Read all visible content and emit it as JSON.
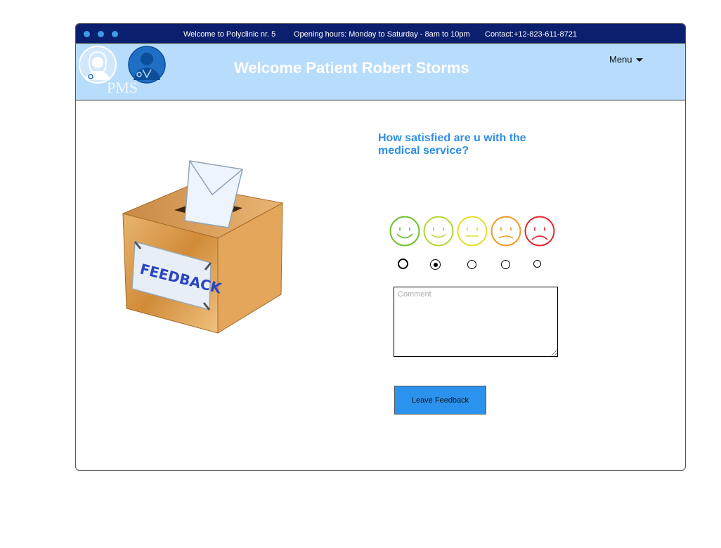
{
  "topbar": {
    "welcome_text": "Welcome to Polyclinic nr. 5",
    "hours_text": "Opening hours: Monday to Saturday - 8am to 10pm",
    "contact_text": "Contact:+12-823-611-8721"
  },
  "header": {
    "logo_text": "PMS",
    "welcome": "Welcome Patient Robert Storms",
    "menu_label": "Menu"
  },
  "illustration": {
    "label": "FEEDBACK"
  },
  "feedback": {
    "question": "How satisfied are u with the medical service?",
    "faces": [
      {
        "icon": "very-satisfied-face-icon",
        "color": "#6dbf2c"
      },
      {
        "icon": "satisfied-face-icon",
        "color": "#b3d630"
      },
      {
        "icon": "neutral-face-icon",
        "color": "#e6dc2a"
      },
      {
        "icon": "unsatisfied-face-icon",
        "color": "#f29a22"
      },
      {
        "icon": "very-unsatisfied-face-icon",
        "color": "#e8242b"
      }
    ],
    "selected_index": 1,
    "comment_placeholder": "Comment",
    "comment_value": "",
    "submit_label": "Leave Feedback"
  },
  "colors": {
    "topbar": "#0b1f6f",
    "header": "#b8dcfb",
    "accent": "#2f8fe6",
    "button": "#2b93ee"
  }
}
